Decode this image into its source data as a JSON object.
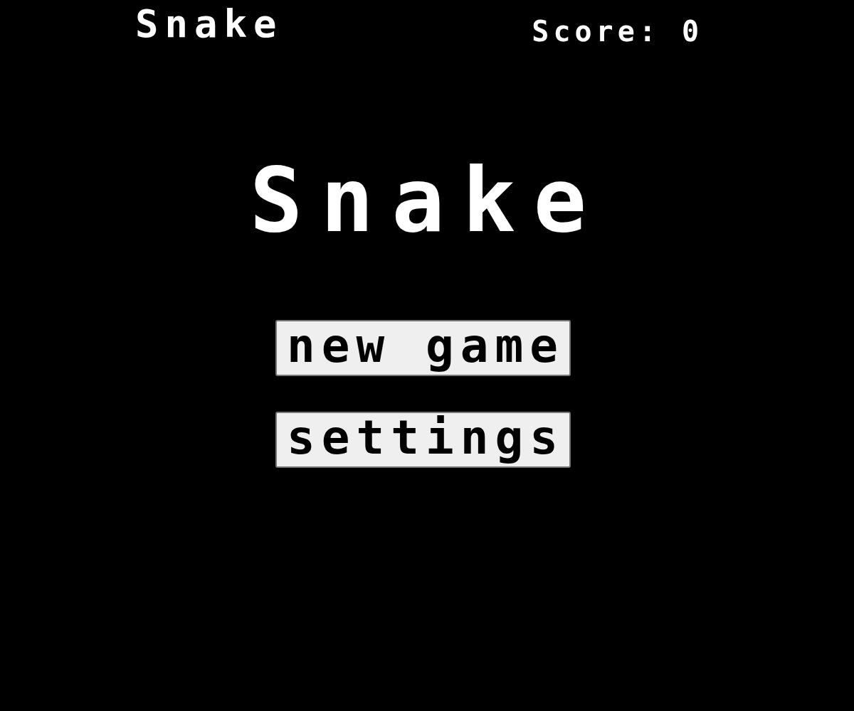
{
  "header": {
    "title": "Snake",
    "score": "Score: 0"
  },
  "title": "Snake",
  "buttons": [
    {
      "label": "new game"
    },
    {
      "label": "settings"
    }
  ]
}
